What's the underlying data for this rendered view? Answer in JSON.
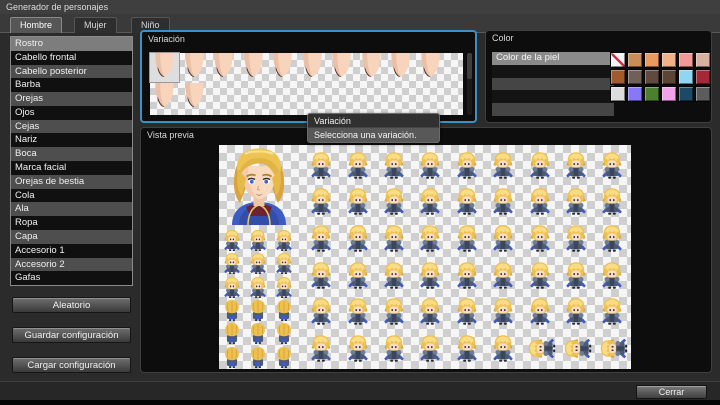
{
  "window": {
    "title": "Generador de personajes"
  },
  "tabs": {
    "items": [
      "Hombre",
      "Mujer",
      "Niño"
    ],
    "selected_index": 0
  },
  "sidebar": {
    "items": [
      "Rostro",
      "Cabello frontal",
      "Cabello posterior",
      "Barba",
      "Orejas",
      "Ojos",
      "Cejas",
      "Nariz",
      "Boca",
      "Marca facial",
      "Orejas de bestia",
      "Cola",
      "Ala",
      "Ropa",
      "Capa",
      "Accesorio 1",
      "Accesorio 2",
      "Gafas"
    ],
    "selected_index": 0,
    "buttons": {
      "random": "Aleatorio",
      "save": "Guardar configuración",
      "load": "Cargar configuración"
    }
  },
  "variation_panel": {
    "title": "Variación",
    "thumb_count": 12,
    "top_row_count": 10,
    "selected_index": 0
  },
  "color_panel": {
    "title": "Color",
    "options": [
      "Color de la piel",
      "",
      "",
      "",
      ""
    ],
    "selected_index": 0,
    "swatches": [
      {
        "name": "none",
        "hex": "#ffffff"
      },
      {
        "name": "skin-tan",
        "hex": "#c98e58"
      },
      {
        "name": "skin-orange",
        "hex": "#e89a60"
      },
      {
        "name": "skin-peach",
        "hex": "#f0b088"
      },
      {
        "name": "skin-pink",
        "hex": "#f49898"
      },
      {
        "name": "skin-beige",
        "hex": "#d8b0a0"
      },
      {
        "name": "brown",
        "hex": "#a05a2e"
      },
      {
        "name": "taupe",
        "hex": "#70605a"
      },
      {
        "name": "dark-brown",
        "hex": "#604a40"
      },
      {
        "name": "umber",
        "hex": "#5e4434"
      },
      {
        "name": "light-cyan",
        "hex": "#8ed6f2"
      },
      {
        "name": "crimson",
        "hex": "#a42838"
      },
      {
        "name": "silver",
        "hex": "#dcdcdc"
      },
      {
        "name": "violet",
        "hex": "#8878f8"
      },
      {
        "name": "green",
        "hex": "#4c8030"
      },
      {
        "name": "pink-lavender",
        "hex": "#f2a2ea"
      },
      {
        "name": "dark-teal",
        "hex": "#1c4a66"
      },
      {
        "name": "gray",
        "hex": "#5c5c5c"
      }
    ]
  },
  "preview_panel": {
    "title": "Vista previa",
    "walk_grid": {
      "cols": 3,
      "rows": 6,
      "back_rows_from": 3
    },
    "battler_grid": {
      "cols": 9,
      "rows": 6,
      "lying_cells": [
        51,
        52,
        53
      ]
    }
  },
  "tooltip": {
    "title": "Variación",
    "text": "Selecciona una variación."
  },
  "footer": {
    "close_label": "Cerrar"
  },
  "colors": {
    "accent_blue": "#3c8fc8",
    "sprite_hair": "#eec04e",
    "sprite_skin": "#fadcc0",
    "sprite_outfit": "#4e5a74",
    "sprite_cape": "#3b5ac2"
  }
}
